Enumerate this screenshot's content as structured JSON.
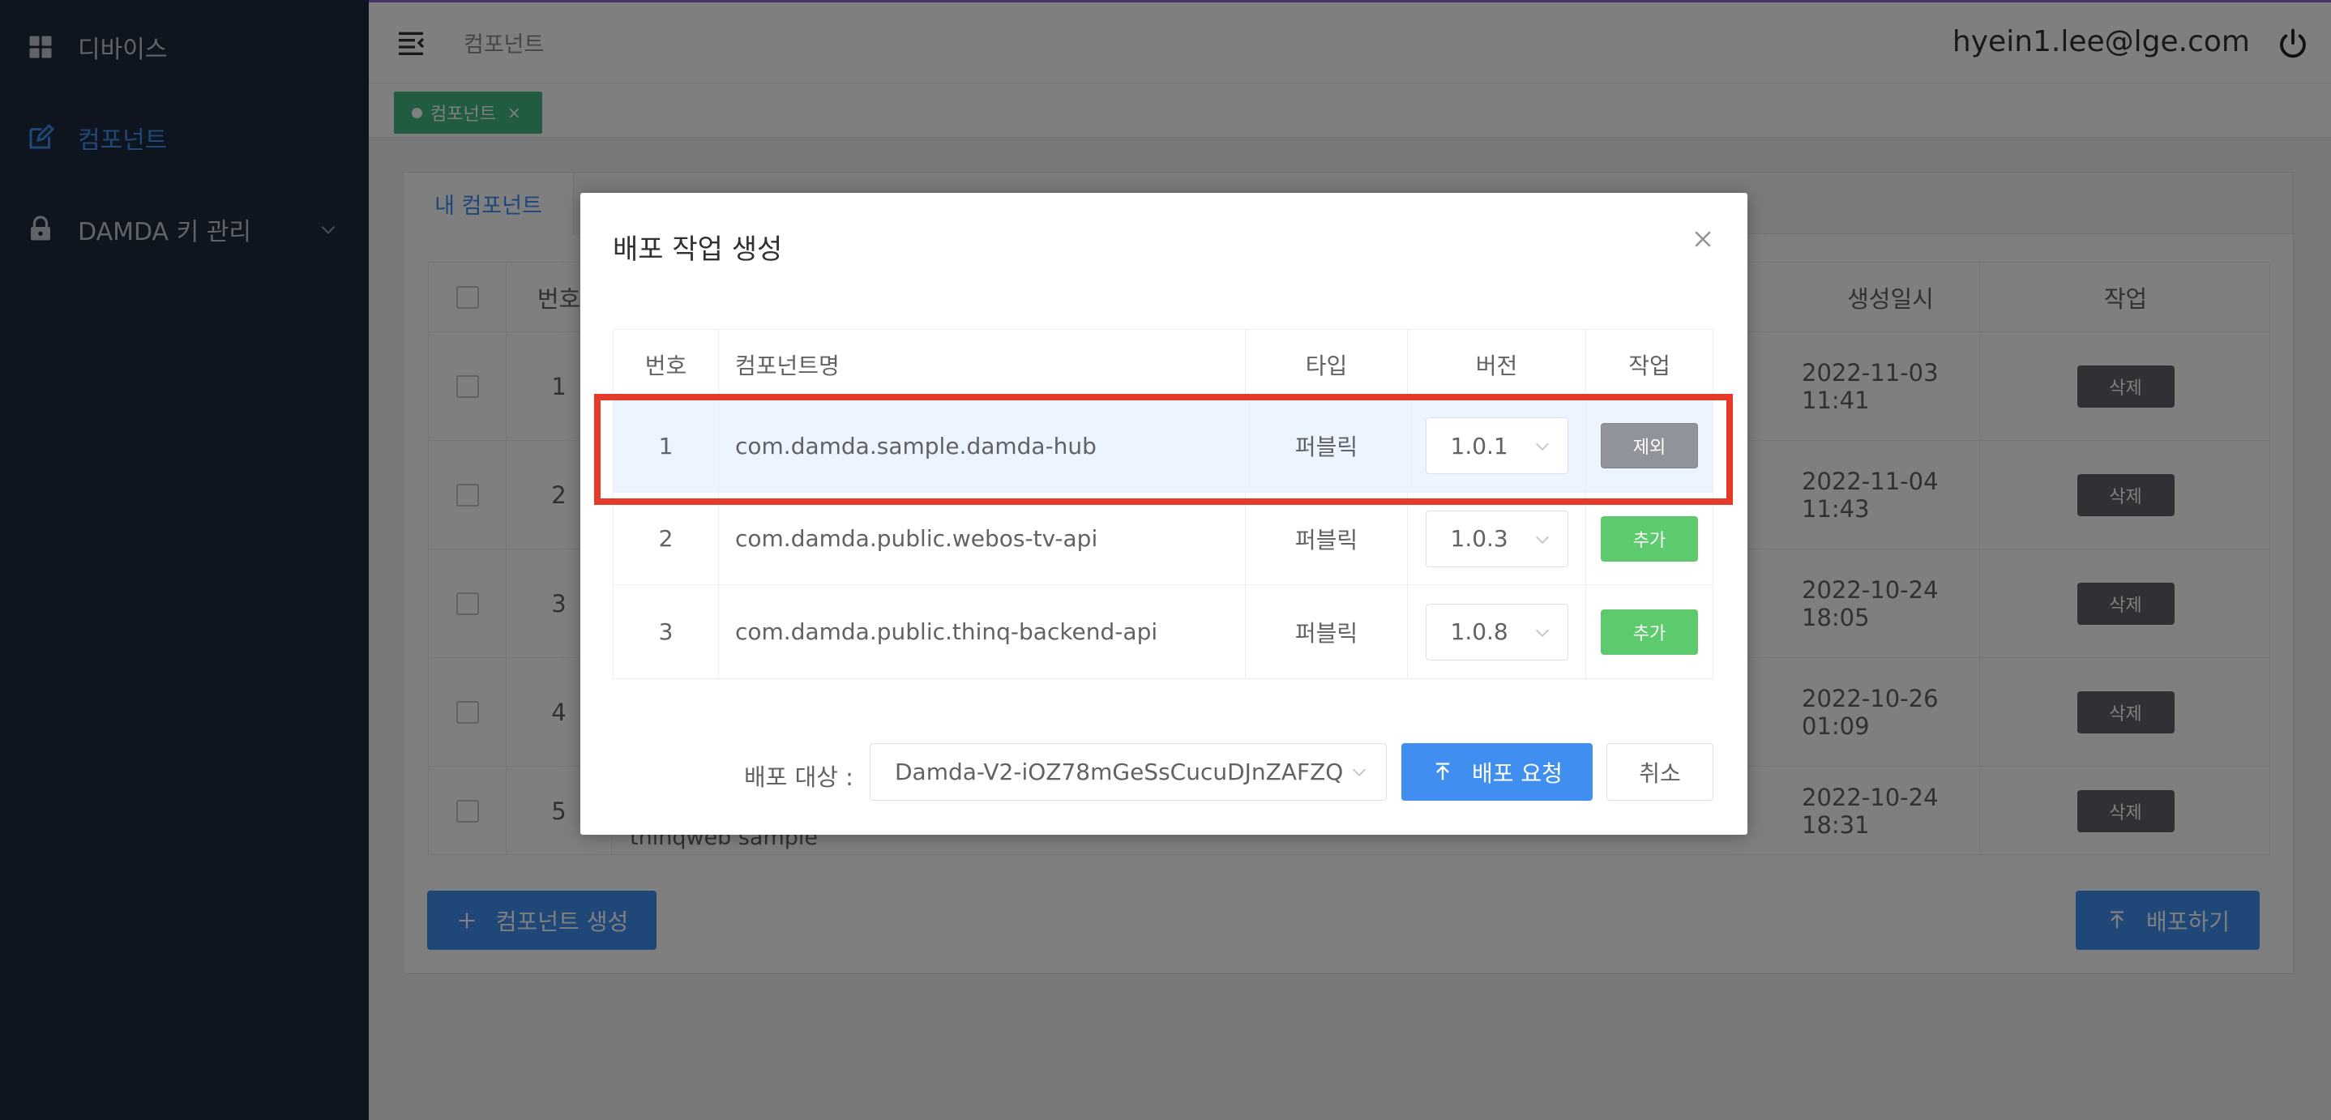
{
  "sidebar": {
    "items": [
      {
        "label": "디바이스",
        "icon": "grid-icon"
      },
      {
        "label": "컴포넌트",
        "icon": "edit-icon"
      },
      {
        "label": "DAMDA 키 관리",
        "icon": "lock-icon"
      }
    ]
  },
  "header": {
    "breadcrumb": "컴포넌트",
    "user_email": "hyein1.lee@lge.com"
  },
  "tags": [
    {
      "label": "컴포넌트",
      "close": "×"
    }
  ],
  "card": {
    "tab": "내 컴포넌트",
    "columns": [
      "번호",
      "생성일시",
      "작업"
    ],
    "rows": [
      {
        "no": "1",
        "created": "2022-11-03 11:41",
        "action": "삭제"
      },
      {
        "no": "2",
        "created": "2022-11-04 11:43",
        "action": "삭제"
      },
      {
        "no": "3",
        "created": "2022-10-24 18:05",
        "action": "삭제"
      },
      {
        "no": "4",
        "created": "2022-10-26 01:09",
        "action": "삭제"
      },
      {
        "no": "5",
        "created": "2022-10-24 18:31",
        "action": "삭제"
      }
    ],
    "visible_fragment": "thinqweb sample",
    "create_button": "컴포넌트 생성",
    "deploy_button": "배포하기"
  },
  "dialog": {
    "title": "배포 작업 생성",
    "columns": [
      "번호",
      "컴포넌트명",
      "타입",
      "버전",
      "작업"
    ],
    "rows": [
      {
        "no": "1",
        "name": "com.damda.sample.damda-hub",
        "type": "퍼블릭",
        "version": "1.0.1",
        "action": "제외",
        "selected": true
      },
      {
        "no": "2",
        "name": "com.damda.public.webos-tv-api",
        "type": "퍼블릭",
        "version": "1.0.3",
        "action": "추가",
        "selected": false
      },
      {
        "no": "3",
        "name": "com.damda.public.thinq-backend-api",
        "type": "퍼블릭",
        "version": "1.0.8",
        "action": "추가",
        "selected": false
      }
    ],
    "target_label": "배포 대상 :",
    "target_value": "Damda-V2-iOZ78mGeSsCucuDJnZAFZQ",
    "request_button": "배포 요청",
    "cancel_button": "취소"
  },
  "colors": {
    "sidebar_bg": "#1f2a3c",
    "accent": "#3f8ef0",
    "tag_green": "#42b983",
    "add_green": "#5dcb6d",
    "exclude_gray": "#909399",
    "highlight_red": "#e53a2a"
  }
}
